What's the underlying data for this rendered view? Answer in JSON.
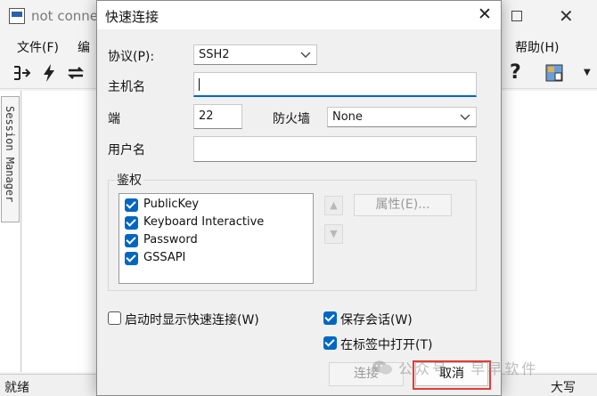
{
  "app": {
    "title": "not conne",
    "menu": {
      "file": "文件(F)",
      "edit": "编",
      "help": "帮助(H)"
    },
    "side_tab": "Session Manager",
    "status": {
      "left": "就绪",
      "right": "大写"
    },
    "toolbar": {
      "help_glyph": "?"
    }
  },
  "dialog": {
    "title": "快速连接",
    "close_glyph": "✕",
    "protocol": {
      "label": "协议(P):",
      "value": "SSH2"
    },
    "hostname": {
      "label": "主机名",
      "value": ""
    },
    "port": {
      "label": "端",
      "value": "22"
    },
    "firewall": {
      "label": "防火墙",
      "value": "None"
    },
    "username": {
      "label": "用户名",
      "value": ""
    },
    "auth": {
      "legend": "鉴权",
      "items": [
        {
          "label": "PublicKey",
          "checked": true
        },
        {
          "label": "Keyboard Interactive",
          "checked": true
        },
        {
          "label": "Password",
          "checked": true
        },
        {
          "label": "GSSAPI",
          "checked": true
        }
      ],
      "up_glyph": "▲",
      "down_glyph": "▼",
      "properties_button": "属性(E)..."
    },
    "options": {
      "show_on_startup": {
        "label": "启动时显示快速连接(W)",
        "checked": false
      },
      "save_session": {
        "label": "保存会话(W)",
        "checked": true
      },
      "open_in_tab": {
        "label": "在标签中打开(T)",
        "checked": true
      }
    },
    "buttons": {
      "connect": "连接",
      "cancel": "取消"
    }
  },
  "watermark": {
    "text": "公众号 · 早早软件"
  },
  "colors": {
    "accent": "#0067c0",
    "highlight": "#e53935"
  }
}
